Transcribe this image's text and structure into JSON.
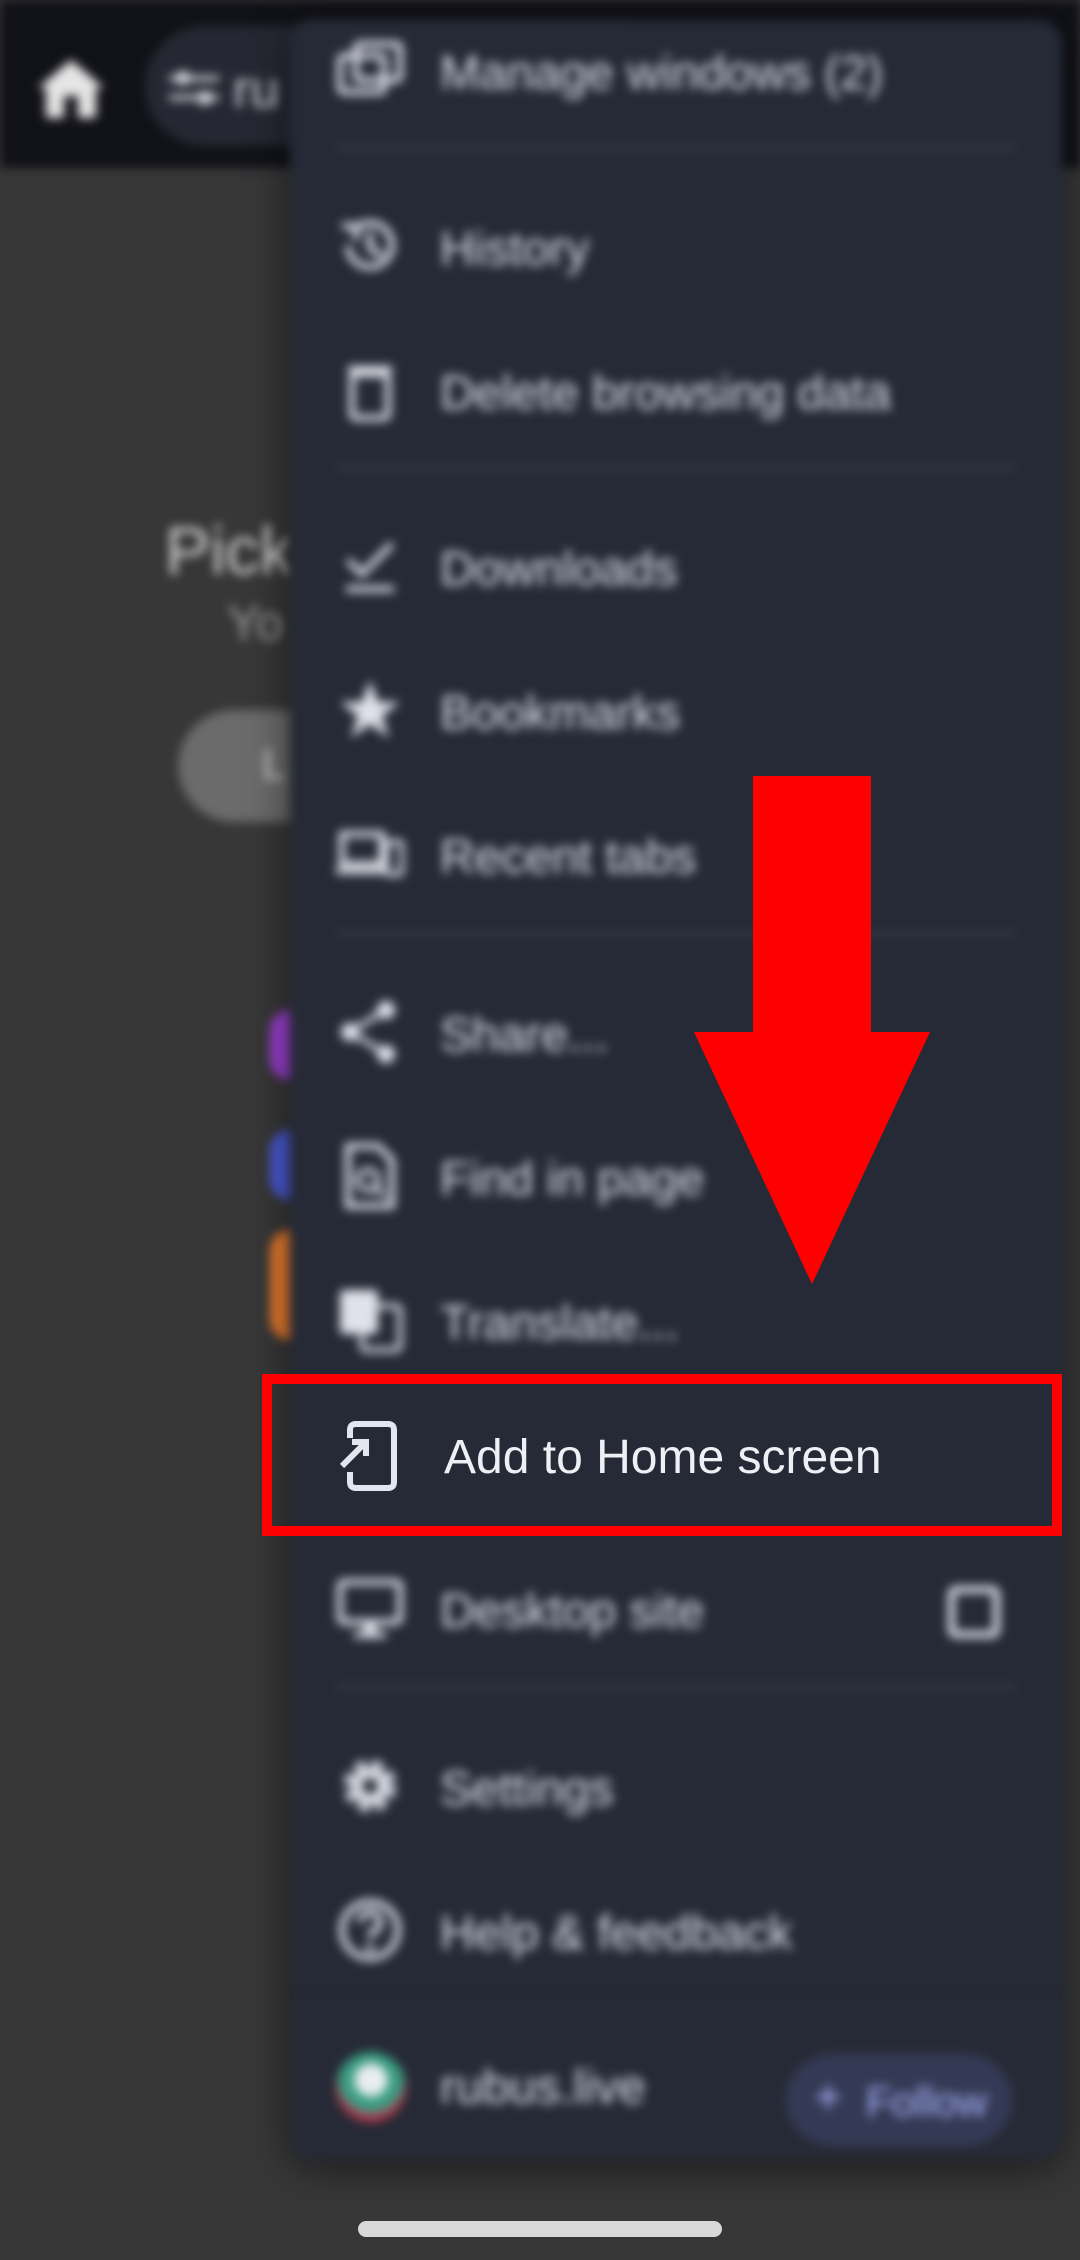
{
  "toolbar": {
    "url_text": "ru"
  },
  "background_page": {
    "title_fragment": "Pick",
    "subtitle_fragment": "Yo",
    "pill_fragment": "L"
  },
  "menu": {
    "items": [
      {
        "label": "Manage windows (2)",
        "icon": "manage-windows-icon"
      },
      {
        "label": "History",
        "icon": "history-icon"
      },
      {
        "label": "Delete browsing data",
        "icon": "trash-icon"
      },
      {
        "label": "Downloads",
        "icon": "downloads-icon"
      },
      {
        "label": "Bookmarks",
        "icon": "star-icon"
      },
      {
        "label": "Recent tabs",
        "icon": "devices-icon"
      },
      {
        "label": "Share...",
        "icon": "share-icon"
      },
      {
        "label": "Find in page",
        "icon": "find-in-page-icon"
      },
      {
        "label": "Translate...",
        "icon": "translate-icon"
      },
      {
        "label": "Add to Home screen",
        "icon": "add-to-home-screen-icon",
        "highlighted": true
      },
      {
        "label": "Desktop site",
        "icon": "desktop-icon",
        "checked": false
      },
      {
        "label": "Settings",
        "icon": "gear-icon"
      },
      {
        "label": "Help & feedback",
        "icon": "help-icon"
      }
    ],
    "site": {
      "name": "rubus.live",
      "follow_label": "Follow",
      "follow_icon": "plus-icon"
    }
  },
  "annotation": {
    "arrow_color": "#ff0000",
    "highlight_color": "#ff0000"
  }
}
